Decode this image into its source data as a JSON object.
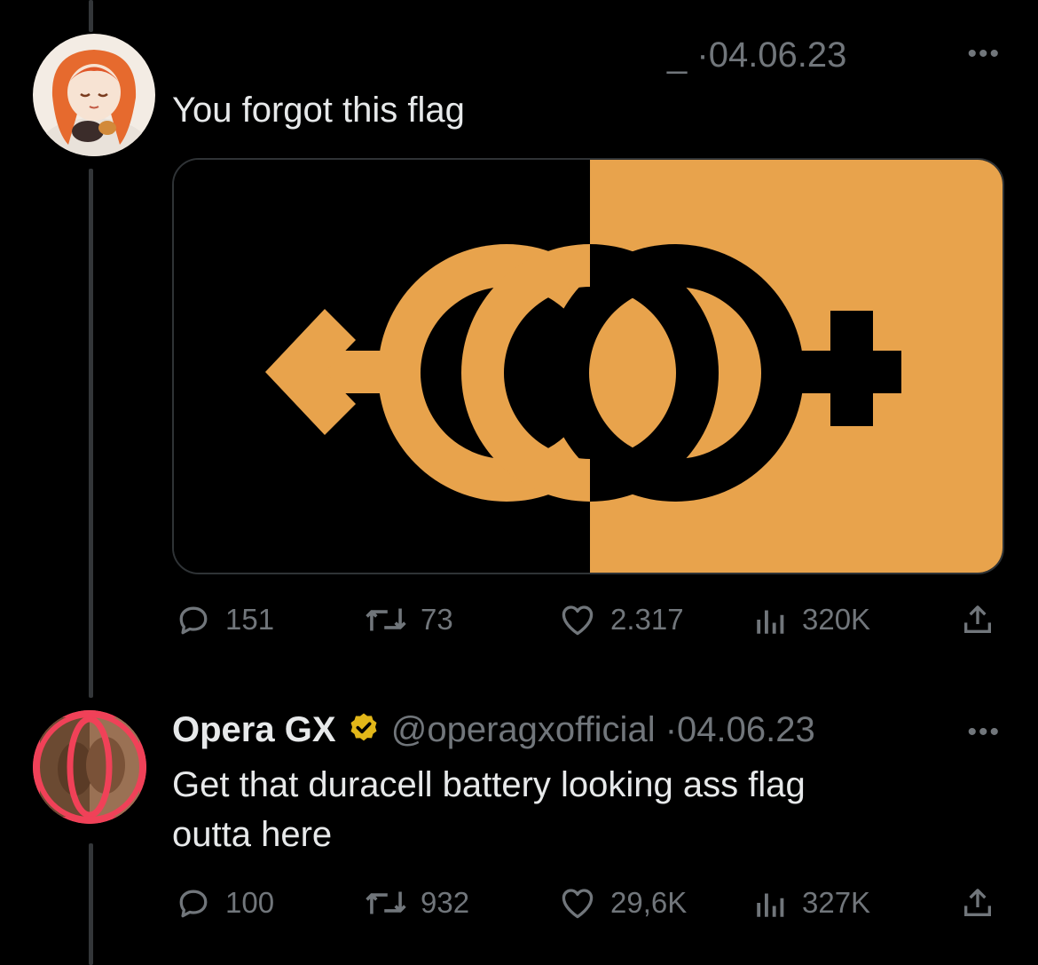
{
  "tweets": [
    {
      "handle": "_",
      "date": "04.06.23",
      "text": "You forgot this flag",
      "more_icon": "more-icon",
      "stats": {
        "replies": "151",
        "retweets": "73",
        "likes": "2.317",
        "views": "320K"
      }
    },
    {
      "name": "Opera GX",
      "verified_icon": "verified-badge-icon",
      "handle": "@operagxofficial",
      "date": "04.06.23",
      "text_line1": "Get that duracell battery looking ass flag",
      "text_line2": "outta here",
      "stats": {
        "replies": "100",
        "retweets": "932",
        "likes": "29,6K",
        "views": "327K"
      }
    }
  ],
  "colors": {
    "background": "#000000",
    "flag_orange": "#e8a34c",
    "verified_gold": "#e2b719",
    "muted": "#71767b"
  },
  "separator": "·"
}
